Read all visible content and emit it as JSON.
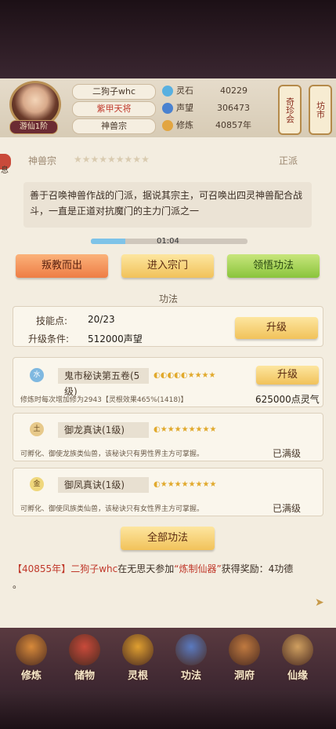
{
  "player": {
    "name": "二狗子whc",
    "title": "紫甲天将",
    "sect": "神兽宗",
    "rank": "游仙1阶"
  },
  "stats": [
    {
      "icon": "spirit-stone-icon",
      "label": "灵石",
      "value": "40229"
    },
    {
      "icon": "prestige-icon",
      "label": "声望",
      "value": "306473"
    },
    {
      "icon": "cultivation-icon",
      "label": "修炼",
      "value": "40857年"
    }
  ],
  "side_scrolls": [
    "奇珍会",
    "坊市"
  ],
  "sect_panel": {
    "name": "神兽宗",
    "alignment": "正派",
    "side_label": "息",
    "description": "善于召唤神兽作战的门派，据说其宗主，可召唤出四灵神兽配合战斗，一直是正道对抗魔门的主力门派之一",
    "timer": "01:04",
    "timer_progress": 0.22
  },
  "actions": {
    "betray": "叛教而出",
    "enter": "进入宗门",
    "comprehend": "领悟功法"
  },
  "techniques_section": {
    "title": "功法",
    "skill_points_label": "技能点:",
    "skill_points_value": "20/23",
    "upgrade_cond_label": "升级条件:",
    "upgrade_cond_value": "512000声望",
    "upgrade_button": "升级"
  },
  "skills": [
    {
      "icon_char": "水",
      "icon_color": "#7fb8e0",
      "name": "鬼市秘诀第五卷(5级)",
      "stars": "◐◐◐◐◐★★★★",
      "desc": "修炼时每次增加修为2943【灵根效果465%(1418)】",
      "desc_highlight": "(1418)",
      "button": "升级",
      "cost": "625000点灵气"
    },
    {
      "icon_char": "土",
      "icon_color": "#e7c98a",
      "name": "御龙真诀(1级)",
      "stars": "◐★★★★★★★★",
      "desc": "可孵化、御使龙族类仙兽，该秘诀只有男性界主方可掌握。",
      "status": "已满级"
    },
    {
      "icon_char": "金",
      "icon_color": "#efd77c",
      "name": "御凤真诀(1级)",
      "stars": "◐★★★★★★★★",
      "desc": "可孵化、御使凤族类仙兽，该秘诀只有女性界主方可掌握。",
      "status": "已满级"
    }
  ],
  "all_techniques_button": "全部功法",
  "broadcast": {
    "year": "【40855年】",
    "player": "二狗子whc",
    "text1": "在无思天参加",
    "event": "“炼制仙器”",
    "text2": "获得奖励：4功德",
    "suffix": "。"
  },
  "nav": [
    {
      "label": "修炼",
      "icon": "cultivate-icon",
      "color": "#d88a3a"
    },
    {
      "label": "储物",
      "icon": "storage-bag-icon",
      "color": "#c94a3a"
    },
    {
      "label": "灵根",
      "icon": "spirit-root-icon",
      "color": "#e0a030"
    },
    {
      "label": "功法",
      "icon": "technique-book-icon",
      "color": "#5a7ac0"
    },
    {
      "label": "洞府",
      "icon": "cave-dwelling-icon",
      "color": "#c07a40"
    },
    {
      "label": "仙缘",
      "icon": "fate-icon",
      "color": "#d0a060"
    }
  ]
}
